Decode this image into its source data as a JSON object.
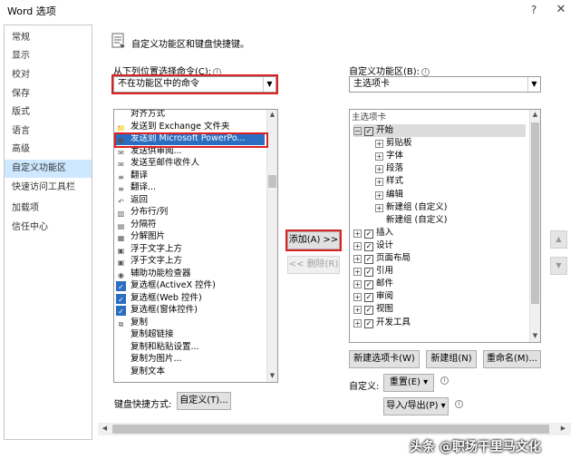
{
  "window": {
    "title": "Word 选项",
    "help_glyph": "?",
    "close_glyph": "✕"
  },
  "sidebar": {
    "items": [
      {
        "label": "常规"
      },
      {
        "label": "显示"
      },
      {
        "label": "校对"
      },
      {
        "label": "保存"
      },
      {
        "label": "版式"
      },
      {
        "label": "语言"
      },
      {
        "label": "高级"
      },
      {
        "label": "自定义功能区",
        "selected": true
      },
      {
        "label": "快速访问工具栏"
      },
      {
        "label": "加载项"
      },
      {
        "label": "信任中心"
      }
    ]
  },
  "header": {
    "text": "自定义功能区和键盘快捷键。"
  },
  "left": {
    "choose_label": "从下列位置选择命令(C):",
    "choose_value": "不在功能区中的命令",
    "commands": [
      {
        "label": "对齐方式",
        "icon": ""
      },
      {
        "label": "发送到 Exchange 文件夹",
        "icon": "📁"
      },
      {
        "label": "发送到 Microsoft PowerPo...",
        "icon": "▣",
        "selected": true
      },
      {
        "label": "发送供审阅...",
        "icon": "✉"
      },
      {
        "label": "发送至邮件收件人",
        "icon": "✉"
      },
      {
        "label": "翻译",
        "icon": "≡"
      },
      {
        "label": "翻译...",
        "icon": "≡"
      },
      {
        "label": "返回",
        "icon": "↶"
      },
      {
        "label": "分布行/列",
        "icon": "▥"
      },
      {
        "label": "分隔符",
        "icon": "▤"
      },
      {
        "label": "分解图片",
        "icon": "▦"
      },
      {
        "label": "浮于文字上方",
        "icon": "▣"
      },
      {
        "label": "浮于文字上方",
        "icon": "▣"
      },
      {
        "label": "辅助功能检查器",
        "icon": "◉"
      },
      {
        "label": "复选框(ActiveX 控件)",
        "icon": "✓",
        "check": true
      },
      {
        "label": "复选框(Web 控件)",
        "icon": "✓",
        "check": true
      },
      {
        "label": "复选框(窗体控件)",
        "icon": "✓",
        "check": true
      },
      {
        "label": "复制",
        "icon": "⧉"
      },
      {
        "label": "复制超链接",
        "icon": ""
      },
      {
        "label": "复制和粘贴设置...",
        "icon": ""
      },
      {
        "label": "复制为图片...",
        "icon": ""
      },
      {
        "label": "复制文本",
        "icon": ""
      }
    ],
    "shortcut_label": "键盘快捷方式:",
    "customize_button": "自定义(T)..."
  },
  "middle": {
    "add_button": "添加(A) >>",
    "remove_button": "<< 删除(R)"
  },
  "right": {
    "ribbon_label": "自定义功能区(B):",
    "ribbon_value": "主选项卡",
    "tree_header": "主选项卡",
    "tree": [
      {
        "label": "开始",
        "level": 0,
        "expander": "⊟",
        "checkbox": true,
        "selected": true
      },
      {
        "label": "剪贴板",
        "level": 1,
        "expander": "⊞"
      },
      {
        "label": "字体",
        "level": 1,
        "expander": "⊞"
      },
      {
        "label": "段落",
        "level": 1,
        "expander": "⊞"
      },
      {
        "label": "样式",
        "level": 1,
        "expander": "⊞"
      },
      {
        "label": "编辑",
        "level": 1,
        "expander": "⊞"
      },
      {
        "label": "新建组 (自定义)",
        "level": 1,
        "expander": "⊞"
      },
      {
        "label": "新建组 (自定义)",
        "level": 1,
        "expander": ""
      },
      {
        "label": "插入",
        "level": 0,
        "expander": "⊞",
        "checkbox": true
      },
      {
        "label": "设计",
        "level": 0,
        "expander": "⊞",
        "checkbox": true
      },
      {
        "label": "页面布局",
        "level": 0,
        "expander": "⊞",
        "checkbox": true
      },
      {
        "label": "引用",
        "level": 0,
        "expander": "⊞",
        "checkbox": true
      },
      {
        "label": "邮件",
        "level": 0,
        "expander": "⊞",
        "checkbox": true
      },
      {
        "label": "审阅",
        "level": 0,
        "expander": "⊞",
        "checkbox": true
      },
      {
        "label": "视图",
        "level": 0,
        "expander": "⊞",
        "checkbox": true
      },
      {
        "label": "开发工具",
        "level": 0,
        "expander": "⊞",
        "checkbox": true
      }
    ],
    "new_tab_button": "新建选项卡(W)",
    "new_group_button": "新建组(N)",
    "rename_button": "重命名(M)...",
    "customize_label": "自定义:",
    "reset_button": "重置(E) ▾",
    "import_export_button": "导入/导出(P) ▾"
  },
  "watermark": "头条 @职场干里马文化",
  "colors": {
    "accent": "#2b6dc0",
    "highlight": "#d22222",
    "selection": "#cde8ff"
  }
}
